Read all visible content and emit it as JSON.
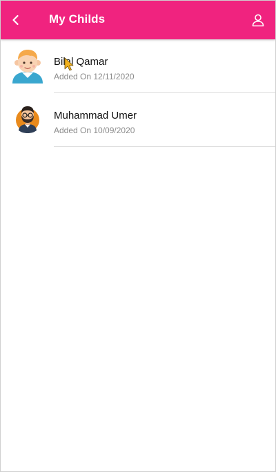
{
  "appbar": {
    "title": "My Childs",
    "back_icon": "chevron-left-icon",
    "profile_icon": "user-icon",
    "color": "#f0237f"
  },
  "children": [
    {
      "name": "Bilal Qamar",
      "added": "Added On 12/11/2020",
      "avatar": "child-avatar"
    },
    {
      "name": "Muhammad Umer",
      "added": "Added On 10/09/2020",
      "avatar": "man-avatar"
    }
  ]
}
